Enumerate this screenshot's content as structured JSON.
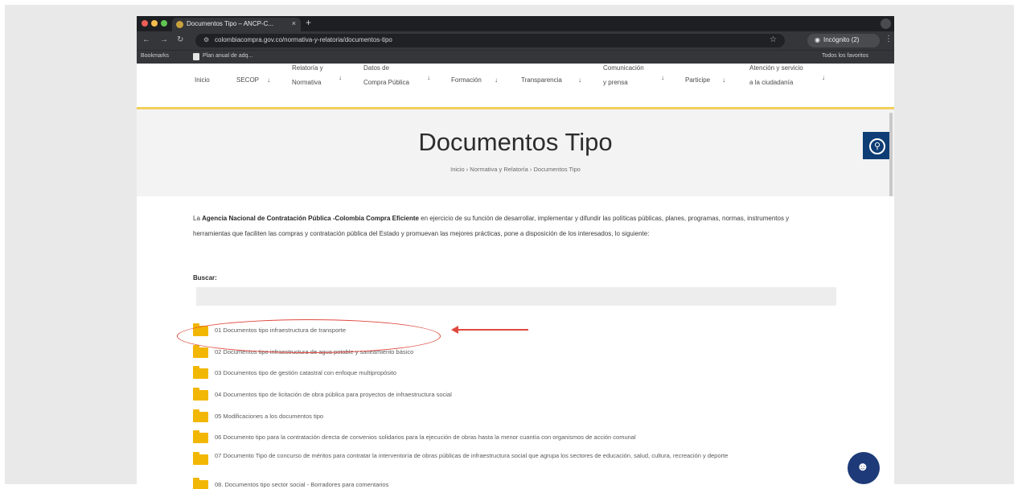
{
  "browser": {
    "tab_title": "Documentos Tipo – ANCP-C...",
    "tab_close": "×",
    "new_tab": "+",
    "url": "colombiacompra.gov.co/normativa-y-relatoria/documentos-tipo",
    "incognito_label": "Incógnito (2)",
    "menu": "⋮",
    "bookmarks": {
      "left": "Bookmarks",
      "item": "Plan anual de adq...",
      "right": "Todos los favoritos"
    }
  },
  "site_nav": {
    "items": [
      {
        "label": "Inicio"
      },
      {
        "label": "SECOP",
        "arrow": "↓"
      },
      {
        "label_line1": "Relatoría y",
        "label_line2": "Normativa",
        "arrow": "↓"
      },
      {
        "label_line1": "Datos de",
        "label_line2": "Compra Pública",
        "arrow": "↓"
      },
      {
        "label": "Formación",
        "arrow": "↓"
      },
      {
        "label": "Transparencia",
        "arrow": "↓"
      },
      {
        "label_line1": "Comunicación",
        "label_line2": "y prensa",
        "arrow": "↓"
      },
      {
        "label": "Participe",
        "arrow": "↓"
      },
      {
        "label_line1": "Atención y servicio",
        "label_line2": "a la ciudadanía",
        "arrow": "↓"
      }
    ]
  },
  "page": {
    "title": "Documentos Tipo",
    "breadcrumb": "Inicio  ›  Normativa y Relatoría  ›  Documentos Tipo",
    "intro_prefix": "La ",
    "intro_bold": "Agencia Nacional de Contratación Pública -Colombia Compra Eficiente",
    "intro_rest": " en ejercicio de su función de desarrollar, implementar y difundir las políticas públicas, planes, programas, normas, instrumentos y herramientas que faciliten las compras y contratación pública del Estado y promuevan las mejores prácticas, pone a disposición de los interesados, lo siguiente:",
    "search_label": "Buscar:",
    "search_value": "",
    "folders": [
      "01 Documentos tipo infraestructura de transporte",
      "02 Documentos tipo infraestructura de agua potable y saneamiento básico",
      "03 Documentos tipo de gestión catastral con enfoque multipropósito",
      "04 Documentos tipo de licitación de obra pública para proyectos de infraestructura social",
      "05 Modificaciones a los documentos tipo",
      "06 Documento tipo para la contratación directa de convenios solidarios para la ejecución de obras hasta la menor cuantía con organismos de acción comunal",
      "07 Documento Tipo de concurso de méritos para contratar la interventoría de obras públicas de infraestructura social que agrupa los sectores de educación, salud, cultura, recreación y deporte",
      "08. Documentos tipo sector social - Borradores para comentarios"
    ]
  },
  "colors": {
    "accent_yellow": "#f2cf5b",
    "folder": "#f2b705",
    "annotation_red": "#e0483e",
    "a11y_blue": "#0e3d75",
    "chat_blue": "#1e3a78"
  },
  "icons": {
    "a11y": "accessibility-icon",
    "chat": "chat-icon",
    "folder": "folder-icon"
  }
}
